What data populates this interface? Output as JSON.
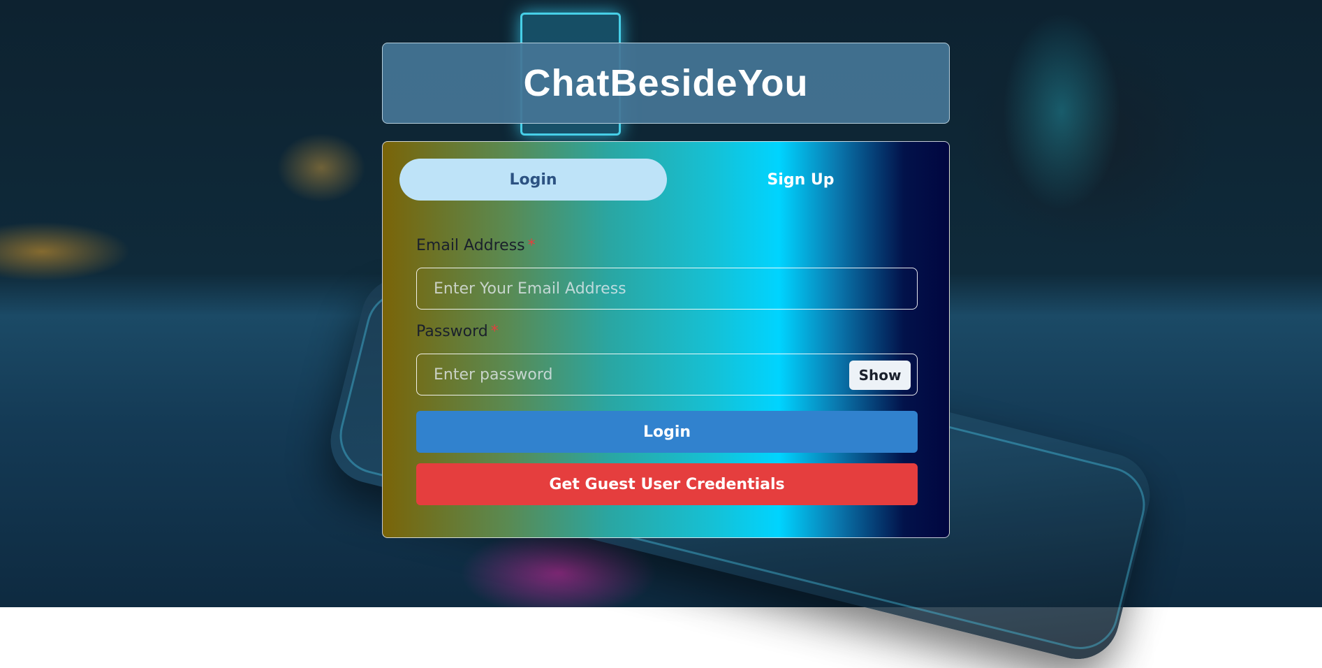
{
  "app": {
    "title": "ChatBesideYou"
  },
  "tabs": [
    {
      "label": "Login",
      "active": true
    },
    {
      "label": "Sign Up",
      "active": false
    }
  ],
  "form": {
    "email": {
      "label": "Email Address",
      "required_mark": "*",
      "placeholder": "Enter Your Email Address",
      "value": ""
    },
    "password": {
      "label": "Password",
      "required_mark": "*",
      "placeholder": "Enter password",
      "value": "",
      "toggle_label": "Show"
    },
    "login_button": "Login",
    "guest_button": "Get Guest User Credentials"
  },
  "colors": {
    "header_bg": "#457596",
    "tab_active_bg": "#bee3f8",
    "tab_active_text": "#2c5282",
    "login_button": "#3182ce",
    "guest_button": "#e53e3e",
    "required": "#e53e3e"
  }
}
